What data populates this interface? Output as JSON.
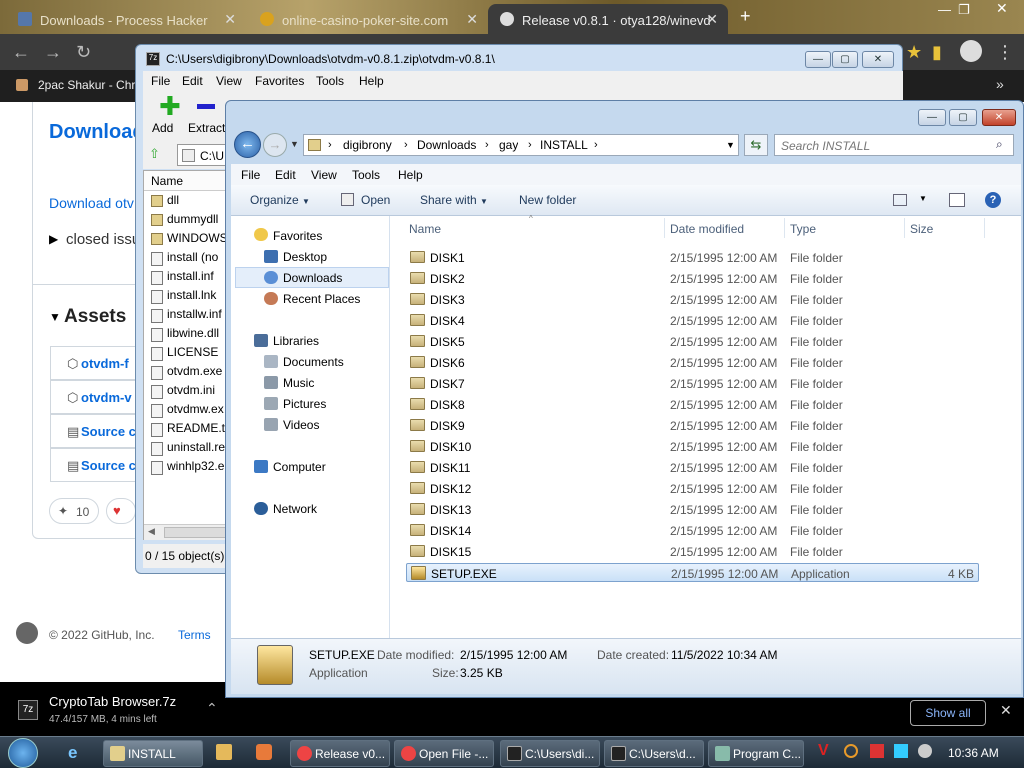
{
  "browser": {
    "tabs": [
      {
        "label": "Downloads - Process Hacker"
      },
      {
        "label": "online-casino-poker-site.com"
      },
      {
        "label": "Release v0.8.1 · otya128/winevd"
      }
    ],
    "bookmark": "2pac Shakur - Chro"
  },
  "github": {
    "heading": "Download",
    "link": "Download otv",
    "closed": "closed issu",
    "assets_title": "Assets",
    "assets": [
      "otvdm-f",
      "otvdm-v",
      "Source c",
      "Source c"
    ],
    "reaction_count": "10",
    "footer_copyright": "© 2022 GitHub, Inc.",
    "footer_terms": "Terms"
  },
  "zip": {
    "title": "C:\\Users\\digibrony\\Downloads\\otvdm-v0.8.1.zip\\otvdm-v0.8.1\\",
    "menu": [
      "File",
      "Edit",
      "View",
      "Favorites",
      "Tools",
      "Help"
    ],
    "toolbar": {
      "add": "Add",
      "extract": "Extract"
    },
    "address": "C:\\U",
    "column_name": "Name",
    "files": [
      "dll",
      "dummydll",
      "WINDOWS",
      "install (no",
      "install.inf",
      "install.lnk",
      "installw.inf",
      "libwine.dll",
      "LICENSE",
      "otvdm.exe",
      "otvdm.ini",
      "otvdmw.ex",
      "README.tx",
      "uninstall.re",
      "winhlp32.e"
    ],
    "status": "0 / 15 object(s)"
  },
  "explorer": {
    "breadcrumb": [
      "digibrony",
      "Downloads",
      "gay",
      "INSTALL"
    ],
    "search_placeholder": "Search INSTALL",
    "menu": [
      "File",
      "Edit",
      "View",
      "Tools",
      "Help"
    ],
    "commands": {
      "organize": "Organize",
      "open": "Open",
      "share": "Share with",
      "new_folder": "New folder"
    },
    "nav": {
      "favorites": "Favorites",
      "favorites_items": [
        "Desktop",
        "Downloads",
        "Recent Places"
      ],
      "libraries": "Libraries",
      "libraries_items": [
        "Documents",
        "Music",
        "Pictures",
        "Videos"
      ],
      "computer": "Computer",
      "network": "Network"
    },
    "columns": {
      "name": "Name",
      "date": "Date modified",
      "type": "Type",
      "size": "Size"
    },
    "rows": [
      {
        "name": "DISK1",
        "date": "2/15/1995 12:00 AM",
        "type": "File folder",
        "size": ""
      },
      {
        "name": "DISK2",
        "date": "2/15/1995 12:00 AM",
        "type": "File folder",
        "size": ""
      },
      {
        "name": "DISK3",
        "date": "2/15/1995 12:00 AM",
        "type": "File folder",
        "size": ""
      },
      {
        "name": "DISK4",
        "date": "2/15/1995 12:00 AM",
        "type": "File folder",
        "size": ""
      },
      {
        "name": "DISK5",
        "date": "2/15/1995 12:00 AM",
        "type": "File folder",
        "size": ""
      },
      {
        "name": "DISK6",
        "date": "2/15/1995 12:00 AM",
        "type": "File folder",
        "size": ""
      },
      {
        "name": "DISK7",
        "date": "2/15/1995 12:00 AM",
        "type": "File folder",
        "size": ""
      },
      {
        "name": "DISK8",
        "date": "2/15/1995 12:00 AM",
        "type": "File folder",
        "size": ""
      },
      {
        "name": "DISK9",
        "date": "2/15/1995 12:00 AM",
        "type": "File folder",
        "size": ""
      },
      {
        "name": "DISK10",
        "date": "2/15/1995 12:00 AM",
        "type": "File folder",
        "size": ""
      },
      {
        "name": "DISK11",
        "date": "2/15/1995 12:00 AM",
        "type": "File folder",
        "size": ""
      },
      {
        "name": "DISK12",
        "date": "2/15/1995 12:00 AM",
        "type": "File folder",
        "size": ""
      },
      {
        "name": "DISK13",
        "date": "2/15/1995 12:00 AM",
        "type": "File folder",
        "size": ""
      },
      {
        "name": "DISK14",
        "date": "2/15/1995 12:00 AM",
        "type": "File folder",
        "size": ""
      },
      {
        "name": "DISK15",
        "date": "2/15/1995 12:00 AM",
        "type": "File folder",
        "size": ""
      },
      {
        "name": "SETUP.EXE",
        "date": "2/15/1995 12:00 AM",
        "type": "Application",
        "size": "4 KB"
      }
    ],
    "details": {
      "filename": "SETUP.EXE",
      "type": "Application",
      "modified_label": "Date modified:",
      "modified": "2/15/1995 12:00 AM",
      "created_label": "Date created:",
      "created": "11/5/2022 10:34 AM",
      "size_label": "Size:",
      "size": "3.25 KB"
    }
  },
  "download": {
    "file": "CryptoTab Browser.7z",
    "progress": "47.4/157 MB, 4 mins left",
    "show_all": "Show all"
  },
  "taskbar": {
    "items": [
      "INSTALL",
      "Release v0...",
      "Open File -...",
      "C:\\Users\\di...",
      "C:\\Users\\d...",
      "Program C..."
    ],
    "clock": "10:36 AM"
  }
}
